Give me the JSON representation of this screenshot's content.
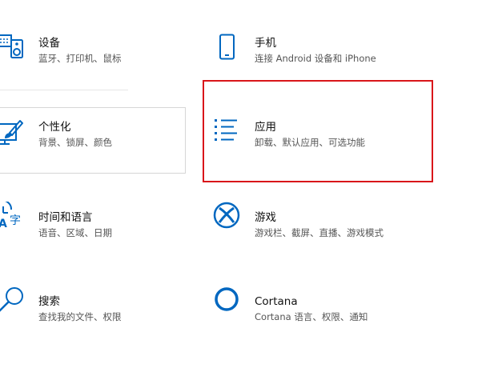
{
  "settings_tiles": [
    {
      "id": "devices",
      "title": "设备",
      "description": "蓝牙、打印机、鼠标",
      "icon": "keyboard-speaker-icon"
    },
    {
      "id": "phone",
      "title": "手机",
      "description": "连接 Android 设备和 iPhone",
      "icon": "phone-icon"
    },
    {
      "id": "personalization",
      "title": "个性化",
      "description": "背景、锁屏、颜色",
      "icon": "paintbrush-monitor-icon"
    },
    {
      "id": "apps",
      "title": "应用",
      "description": "卸载、默认应用、可选功能",
      "icon": "list-icon"
    },
    {
      "id": "time-language",
      "title": "时间和语言",
      "description": "语音、区域、日期",
      "icon": "clock-language-icon"
    },
    {
      "id": "gaming",
      "title": "游戏",
      "description": "游戏栏、截屏、直播、游戏模式",
      "icon": "xbox-icon"
    },
    {
      "id": "search",
      "title": "搜索",
      "description": "查找我的文件、权限",
      "icon": "magnifier-icon"
    },
    {
      "id": "cortana",
      "title": "Cortana",
      "description": "Cortana 语言、权限、通知",
      "icon": "cortana-ring-icon"
    }
  ],
  "colors": {
    "accent": "#0067c0",
    "highlight": "#d9161a",
    "title_text": "#111111",
    "description_text": "#555555"
  }
}
